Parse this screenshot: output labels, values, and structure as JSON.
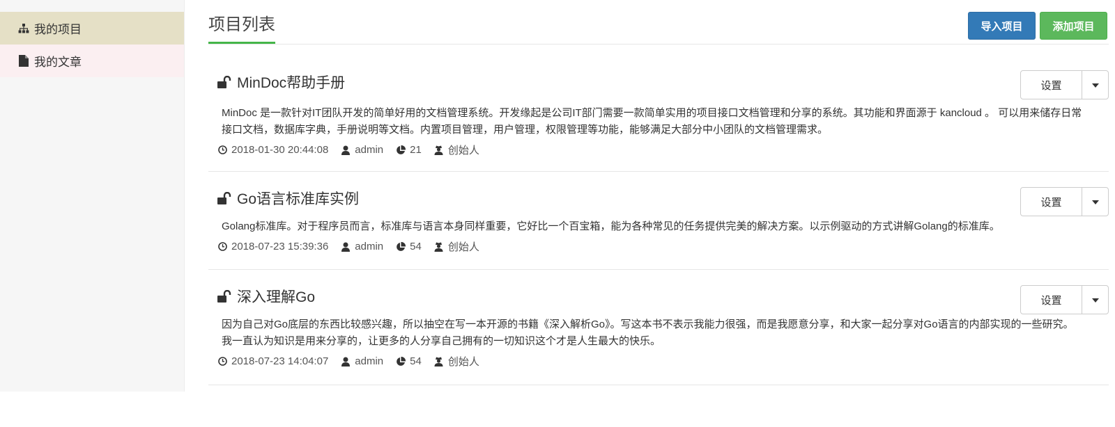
{
  "sidebar": {
    "items": [
      {
        "label": "我的项目",
        "icon": "sitemap-icon"
      },
      {
        "label": "我的文章",
        "icon": "file-icon"
      }
    ]
  },
  "header": {
    "title": "项目列表",
    "import_label": "导入项目",
    "add_label": "添加项目"
  },
  "colors": {
    "accent_green": "#44b549",
    "import_blue": "#337ab7",
    "add_green": "#5cb85c",
    "active_item_bg": "#e5e0c6",
    "secondary_item_bg": "#fbeff1"
  },
  "projects": [
    {
      "title": "MinDoc帮助手册",
      "description": "MinDoc 是一款针对IT团队开发的简单好用的文档管理系统。开发缘起是公司IT部门需要一款简单实用的项目接口文档管理和分享的系统。其功能和界面源于 kancloud 。 可以用来储存日常接口文档，数据库字典，手册说明等文档。内置项目管理，用户管理，权限管理等功能，能够满足大部分中小团队的文档管理需求。",
      "time": "2018-01-30 20:44:08",
      "author": "admin",
      "count": "21",
      "role": "创始人",
      "setting_label": "设置"
    },
    {
      "title": "Go语言标准库实例",
      "description": "Golang标准库。对于程序员而言，标准库与语言本身同样重要，它好比一个百宝箱，能为各种常见的任务提供完美的解决方案。以示例驱动的方式讲解Golang的标准库。",
      "time": "2018-07-23 15:39:36",
      "author": "admin",
      "count": "54",
      "role": "创始人",
      "setting_label": "设置"
    },
    {
      "title": "深入理解Go",
      "description": "因为自己对Go底层的东西比较感兴趣，所以抽空在写一本开源的书籍《深入解析Go》。写这本书不表示我能力很强，而是我愿意分享，和大家一起分享对Go语言的内部实现的一些研究。 我一直认为知识是用来分享的，让更多的人分享自己拥有的一切知识这个才是人生最大的快乐。",
      "time": "2018-07-23 14:04:07",
      "author": "admin",
      "count": "54",
      "role": "创始人",
      "setting_label": "设置"
    }
  ]
}
